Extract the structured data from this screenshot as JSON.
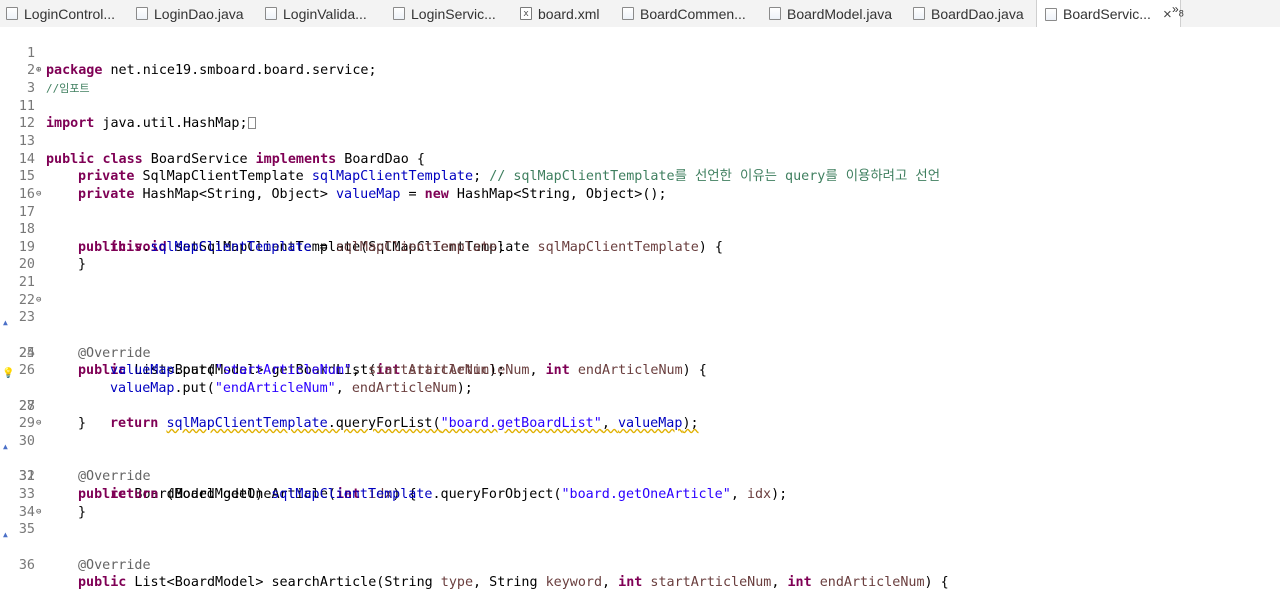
{
  "tabs": [
    {
      "label": "LoginControl...",
      "icon": "java-file-icon"
    },
    {
      "label": "LoginDao.java",
      "icon": "java-file-icon"
    },
    {
      "label": "LoginValida...",
      "icon": "java-file-icon"
    },
    {
      "label": "LoginServic...",
      "icon": "java-file-icon"
    },
    {
      "label": "board.xml",
      "icon": "xml-file-icon"
    },
    {
      "label": "BoardCommen...",
      "icon": "java-file-icon"
    },
    {
      "label": "BoardModel.java",
      "icon": "java-file-icon"
    },
    {
      "label": "BoardDao.java",
      "icon": "java-file-icon"
    },
    {
      "label": "BoardServic...",
      "icon": "java-file-icon",
      "active": true
    }
  ],
  "overflow": {
    "symbol": "»",
    "count": "8"
  },
  "close_symbol": "×",
  "lines": [
    {
      "n": "1"
    },
    {
      "n": "2"
    },
    {
      "n": "3"
    },
    {
      "n": "11"
    },
    {
      "n": "12"
    },
    {
      "n": "13"
    },
    {
      "n": "14"
    },
    {
      "n": "15"
    },
    {
      "n": "16"
    },
    {
      "n": "17"
    },
    {
      "n": "18"
    },
    {
      "n": "19"
    },
    {
      "n": "20"
    },
    {
      "n": "21"
    },
    {
      "n": "22"
    },
    {
      "n": "23"
    },
    {
      "n": "24"
    },
    {
      "n": "25"
    },
    {
      "n": "26"
    },
    {
      "n": "27"
    },
    {
      "n": "28"
    },
    {
      "n": "29"
    },
    {
      "n": "30"
    },
    {
      "n": "31"
    },
    {
      "n": "32"
    },
    {
      "n": "33"
    },
    {
      "n": "34"
    },
    {
      "n": "35"
    },
    {
      "n": "36"
    }
  ],
  "code": {
    "l1_kw": "package",
    "l1_rest": " net.nice19.smboard.board.service;",
    "l2_cm": "//임포트",
    "l3_kw": "import",
    "l3_rest": " java.util.HashMap;",
    "l13_a": "public",
    "l13_b": " ",
    "l13_c": "class",
    "l13_d": " BoardService ",
    "l13_e": "implements",
    "l13_f": " BoardDao {",
    "l14_a": "private",
    "l14_b": " SqlMapClientTemplate ",
    "l14_c": "sqlMapClientTemplate",
    "l14_d": "; ",
    "l14_e": "// sqlMapClientTemplate를 선언한 이유는 query를 이용하려고 선언",
    "l15_a": "private",
    "l15_b": " HashMap<String, Object> ",
    "l15_c": "valueMap",
    "l15_d": " = ",
    "l15_e": "new",
    "l15_f": " HashMap<String, Object>();",
    "l17_a": "public",
    "l17_b": " ",
    "l17_c": "void",
    "l17_d": " setSqlMapClientTemplate(SqlMapClientTemplate ",
    "l17_e": "sqlMapClientTemplate",
    "l17_f": ") {",
    "l18_a": "this",
    "l18_b": ".",
    "l18_c": "sqlMapClientTemplate",
    "l18_d": " = ",
    "l18_e": "sqlMapClientTemplate",
    "l18_f": ";",
    "l19": "}",
    "l23": "@Override",
    "l24_a": "public",
    "l24_b": " List<BoardModel> getBoardList(",
    "l24_c": "int",
    "l24_d": " ",
    "l24_e": "startArticleNum",
    "l24_f": ", ",
    "l24_g": "int",
    "l24_h": " ",
    "l24_i": "endArticleNum",
    "l24_j": ") {",
    "l25_a": "valueMap",
    "l25_b": ".put(",
    "l25_c": "\"startArticleNum\"",
    "l25_d": ", ",
    "l25_e": "startArticleNum",
    "l25_f": ");",
    "l26_a": "valueMap",
    "l26_b": ".put(",
    "l26_c": "\"endArticleNum\"",
    "l26_d": ", ",
    "l26_e": "endArticleNum",
    "l26_f": ");",
    "l27_a": "return",
    "l27_b": " ",
    "l27_c": "sqlMapClientTemplate",
    "l27_d": ".queryForList(",
    "l27_e": "\"board.getBoardList\"",
    "l27_f": ", ",
    "l27_g": "valueMap",
    "l27_h": ");",
    "l28": "}",
    "l30": "@Override",
    "l31_a": "public",
    "l31_b": " BoardModel getOneArticle(",
    "l31_c": "int",
    "l31_d": " ",
    "l31_e": "idx",
    "l31_f": ") {",
    "l32_a": "return",
    "l32_b": " (BoardModel) ",
    "l32_c": "sqlMapClientTemplate",
    "l32_d": ".queryForObject(",
    "l32_e": "\"board.getOneArticle\"",
    "l32_f": ", ",
    "l32_g": "idx",
    "l32_h": ");",
    "l33": "}",
    "l35": "@Override",
    "l36_a": "public",
    "l36_b": " List<BoardModel> searchArticle(String ",
    "l36_c": "type",
    "l36_d": ", String ",
    "l36_e": "keyword",
    "l36_f": ", ",
    "l36_g": "int",
    "l36_h": " ",
    "l36_i": "startArticleNum",
    "l36_j": ", ",
    "l36_k": "int",
    "l36_l": " ",
    "l36_m": "endArticleNum",
    "l36_n": ") {"
  },
  "colors": {
    "keyword": "#7f0055",
    "field": "#0000c0",
    "string": "#2a00ff",
    "comment": "#3f7f5f",
    "annotation": "#646464",
    "param": "#6a3e3e"
  }
}
